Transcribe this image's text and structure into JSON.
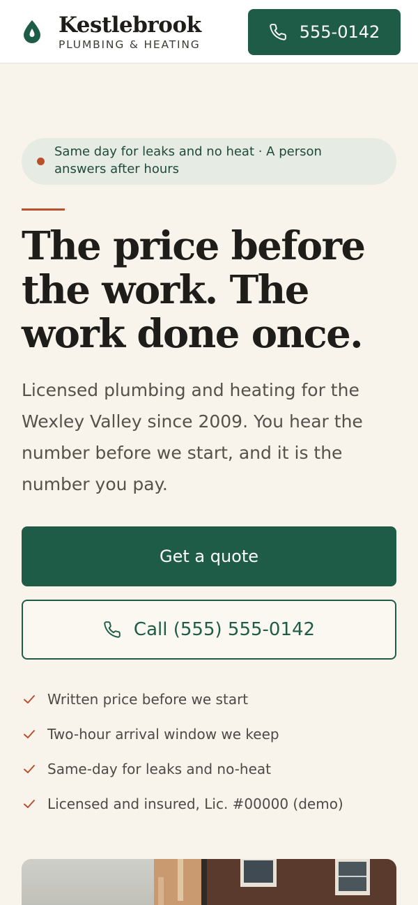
{
  "header": {
    "brand_name": "Kestlebrook",
    "brand_tagline": "PLUMBING & HEATING",
    "logo_icon": "water-drop-icon",
    "call_label": "555-0142",
    "call_icon": "phone-icon"
  },
  "hero": {
    "badge_text": "Same day for leaks and no heat · A person answers after hours",
    "headline": "The price before the work. The work done once.",
    "lede": "Licensed plumbing and heating for the Wexley Valley since 2009. You hear the number before we start, and it is the number you pay.",
    "primary_cta": "Get a quote",
    "secondary_cta": "Call (555) 555-0142",
    "checklist": [
      "Written price before we start",
      "Two-hour arrival window we keep",
      "Same-day for leaks and no-heat",
      "Licensed and insured, Lic. #00000 (demo)"
    ]
  },
  "colors": {
    "brand_green": "#1f5c47",
    "accent_rust": "#b8502c",
    "page_background": "#f8f4ec",
    "badge_background": "#e6ebe3"
  }
}
